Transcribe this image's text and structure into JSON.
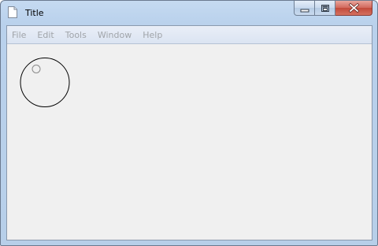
{
  "window": {
    "title": "Title",
    "icon": "document-icon",
    "caption_buttons": [
      "minimize-icon",
      "maximize-icon",
      "close-icon"
    ]
  },
  "menubar": {
    "items": [
      {
        "label": "File"
      },
      {
        "label": "Edit"
      },
      {
        "label": "Tools"
      },
      {
        "label": "Window"
      },
      {
        "label": "Help"
      }
    ]
  },
  "canvas": {
    "shapes": [
      "large-circle",
      "small-circle"
    ]
  },
  "colors": {
    "titlebar": "#b9d1ec",
    "close_button": "#c9493c",
    "client_background": "#f0f0f0",
    "menu_text_disabled": "#a0a4a9"
  }
}
